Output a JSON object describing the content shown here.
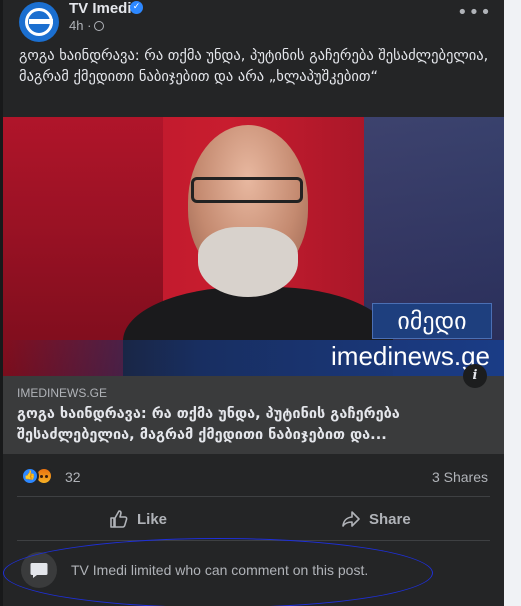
{
  "post": {
    "page_name": "TV Imedi",
    "time": "4h",
    "text": "გოგა ხაინდრავა: რა თქმა უნდა, პუტინის გაჩერება შესაძლებელია, მაგრამ ქმედითი ნაბიჯებით და არა „ხლაპუშკებით“"
  },
  "image": {
    "channel_logo": "იმედი",
    "site_watermark": "imedinews.ge"
  },
  "link": {
    "domain": "IMEDINEWS.GE",
    "title": "გოგა ხაინდრავა: რა თქმა უნდა, პუტინის გაჩერება შესაძლებელია, მაგრამ ქმედითი ნაბიჯებით და...",
    "info_glyph": "i"
  },
  "reactions": {
    "count": "32",
    "shares": "3 Shares"
  },
  "actions": {
    "like_label": "Like",
    "share_label": "Share"
  },
  "comments": {
    "notice": "TV Imedi limited who can comment on this post."
  },
  "colors": {
    "card_bg": "#242526",
    "accent_blue": "#2d88ff",
    "annotation": "#1e2fd8"
  },
  "icons": {
    "avatar": "imedi-logo",
    "verified": "verified-badge-icon",
    "audience": "globe-icon",
    "more": "more-dots-icon",
    "like": "thumbs-up-icon",
    "share": "share-arrow-icon",
    "comment": "comment-bubble-icon"
  }
}
